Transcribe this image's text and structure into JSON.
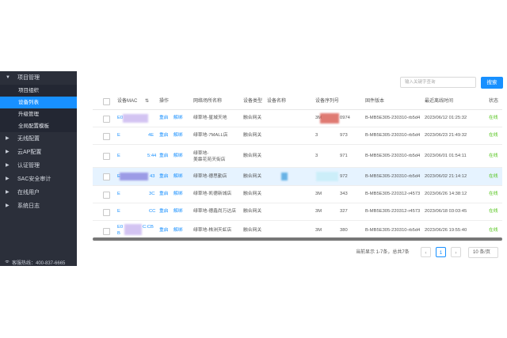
{
  "sidebar": {
    "groups": [
      {
        "label": "项目管理",
        "children": [
          {
            "label": "项目组织",
            "active": false
          },
          {
            "label": "设备列表",
            "active": true
          },
          {
            "label": "升级管理",
            "active": false
          },
          {
            "label": "全局配置模板",
            "active": false
          }
        ]
      },
      {
        "label": "无线配置"
      },
      {
        "label": "云AP配置"
      },
      {
        "label": "认证管理"
      },
      {
        "label": "SAC安全审计"
      },
      {
        "label": "在线用户"
      },
      {
        "label": "系统日志"
      }
    ],
    "hotline": "客服热线：400-837-6665"
  },
  "toolbar": {
    "search_placeholder": "输入关键字查询",
    "search_button": "搜索"
  },
  "table": {
    "headers": [
      "设备MAC",
      "操作",
      "网络场所名称",
      "设备类型",
      "设备名称",
      "设备序列号",
      "固件版本",
      "最近离线时间",
      "状态"
    ],
    "rows": [
      {
        "mac": "E0",
        "mac_tail": "",
        "actions": [
          "重启",
          "解绑"
        ],
        "place": "绿草地-星城天地",
        "type": "融合网关",
        "serial_head": "3M",
        "serial_tail": "0974",
        "firmware": "B-MB5E305-230310-rb5d4",
        "last_offline": "2023/06/12 01:25:32",
        "status": "在线"
      },
      {
        "mac": "E",
        "mac_tail": "4E",
        "actions": [
          "重启",
          "解绑"
        ],
        "place": "绿草地-7MALL店",
        "type": "融合网关",
        "serial_head": "3",
        "serial_tail": "973",
        "firmware": "B-MB5E305-230310-rb5d4",
        "last_offline": "2023/06/23 21:49:32",
        "status": "在线"
      },
      {
        "mac": "E",
        "mac_tail": "5:44",
        "actions": [
          "重启",
          "解绑"
        ],
        "place": "绿草地-\n美霖花苑天街店",
        "type": "融合网关",
        "serial_head": "3",
        "serial_tail": "971",
        "firmware": "B-MB5E305-230310-rb5d4",
        "last_offline": "2023/06/01 01:54:11",
        "status": "在线"
      },
      {
        "mac": "E",
        "mac_tail": "43",
        "actions": [
          "重启",
          "解绑"
        ],
        "place": "绿草地-德思勤店",
        "type": "融合网关",
        "serial_head": "",
        "serial_tail": "972",
        "firmware": "B-MB5E305-230310-rb5d4",
        "last_offline": "2023/06/02 21:14:12",
        "status": "在线"
      },
      {
        "mac": "E",
        "mac_tail": "3C",
        "actions": [
          "重启",
          "解绑"
        ],
        "place": "绿草地-凯德新城店",
        "type": "融合网关",
        "serial_head": "3M",
        "serial_tail": "343",
        "firmware": "B-MB5E305-220312-r4573",
        "last_offline": "2023/06/26 14:38:12",
        "status": "在线"
      },
      {
        "mac": "E",
        "mac_tail": "CC",
        "actions": [
          "重启",
          "解绑"
        ],
        "place": "绿草地-德鑫尚万达店",
        "type": "融合网关",
        "serial_head": "3M",
        "serial_tail": "327",
        "firmware": "B-MB5E305-220312-r4573",
        "last_offline": "2023/06/18 03:03:45",
        "status": "在线"
      },
      {
        "mac": "E0",
        "mac_tail": "C:CB",
        "mac_line2": "B",
        "actions": [
          "重启",
          "解绑"
        ],
        "place": "绿草地-株洲天虹店",
        "type": "融合网关",
        "serial_head": "3M",
        "serial_tail": "380",
        "firmware": "B-MB5E305-230310-rb5d4",
        "last_offline": "2023/06/26 19:55:40",
        "status": "在线"
      }
    ]
  },
  "pagination": {
    "summary": "当前显示 1-7条，总共7条",
    "prev": "‹",
    "current": "1",
    "next": "›",
    "page_size": "10 条/页"
  },
  "colors": {
    "sidebar_bg": "#2b2f3a",
    "accent": "#1890ff",
    "online": "#52c41a",
    "highlight_row": "#e6f3ff"
  }
}
